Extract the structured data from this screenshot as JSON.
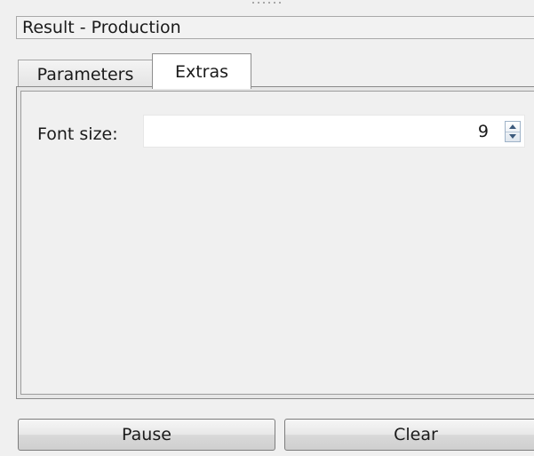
{
  "window": {
    "title": "Result - Production"
  },
  "tabs": [
    {
      "label": "Parameters",
      "active": false
    },
    {
      "label": "Extras",
      "active": true
    }
  ],
  "extras": {
    "font_size_label": "Font size:",
    "font_size_value": "9"
  },
  "actions": {
    "pause_label": "Pause",
    "clear_label": "Clear"
  },
  "icons": {
    "spin_up": "chevron-up-icon",
    "spin_down": "chevron-down-icon"
  },
  "colors": {
    "window_bg": "#f0f0f0",
    "active_tab_bg": "#ffffff",
    "spin_arrow": "#3c5a7c"
  }
}
